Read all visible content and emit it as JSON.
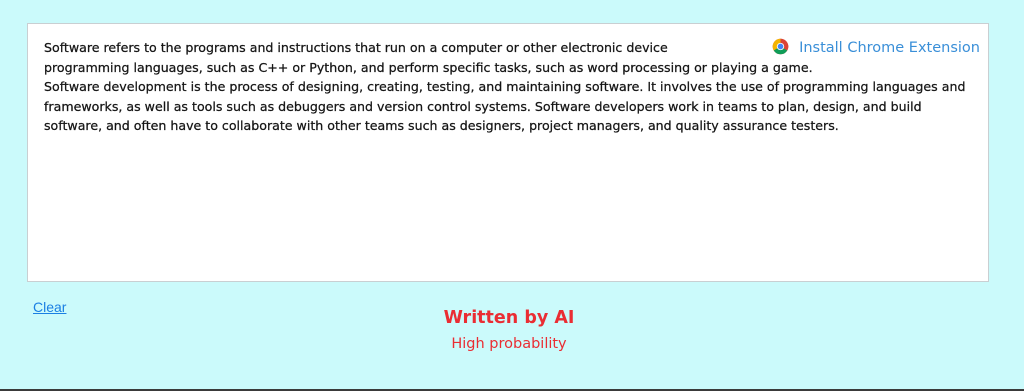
{
  "editor": {
    "line1": "Software refers to the programs and instructions that run on a computer or other electronic device",
    "line2": "programming languages, such as C++ or Python, and perform specific tasks, such as word processing or playing a game.",
    "paragraph2": "Software development is the process of designing, creating, testing, and maintaining software. It involves the use of programming languages and frameworks, as well as tools such as debuggers and version control systems. Software developers work in teams to plan, design, and build software, and often have to collaborate with other teams such as designers, project managers, and quality assurance testers."
  },
  "extension": {
    "icon": "chrome-icon",
    "label": "Install Chrome Extension"
  },
  "actions": {
    "clear_label": "Clear"
  },
  "result": {
    "verdict": "Written by AI",
    "probability": "High probability"
  },
  "colors": {
    "background": "#cbfafb",
    "verdict": "#ea2d33",
    "link": "#1b7fe3",
    "extension_link": "#3a8fd8"
  }
}
